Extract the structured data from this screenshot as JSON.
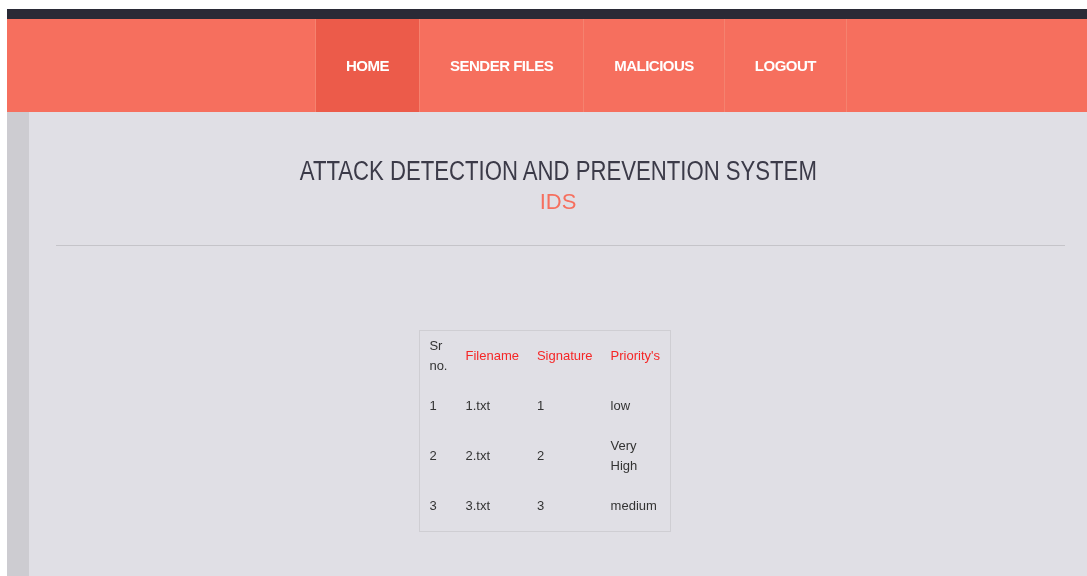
{
  "nav": {
    "items": [
      {
        "label": "HOME",
        "selected": true
      },
      {
        "label": "SENDER FILES",
        "selected": false
      },
      {
        "label": "MALICIOUS",
        "selected": false
      },
      {
        "label": "LOGOUT",
        "selected": false
      }
    ]
  },
  "header": {
    "title": "ATTACK DETECTION AND PREVENTION SYSTEM",
    "subtitle": "IDS"
  },
  "table": {
    "columns": [
      "Sr no.",
      "Filename",
      "Signature",
      "Priority's"
    ],
    "rows": [
      [
        "1",
        "1.txt",
        "1",
        "low"
      ],
      [
        "2",
        "2.txt",
        "2",
        "Very High"
      ],
      [
        "3",
        "3.txt",
        "3",
        "medium"
      ]
    ]
  }
}
